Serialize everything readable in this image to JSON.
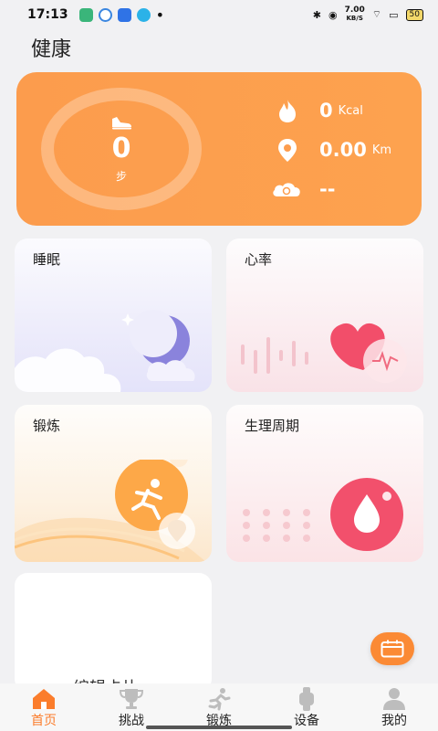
{
  "status_bar": {
    "time": "17:13",
    "net_speed_value": "7.00",
    "net_speed_unit": "KB/S",
    "battery": "50"
  },
  "page": {
    "title": "健康"
  },
  "summary": {
    "steps_value": "0",
    "steps_unit": "步",
    "calories_value": "0",
    "calories_unit": "Kcal",
    "distance_value": "0.00",
    "distance_unit": "Km",
    "sync_value": "--",
    "accent_color": "#fd9d4e"
  },
  "tiles": {
    "sleep": "睡眠",
    "heart_rate": "心率",
    "exercise": "锻炼",
    "cycle": "生理周期",
    "edit_card": "编辑卡片"
  },
  "bottom_nav": {
    "items": [
      {
        "label": "首页",
        "icon": "home-icon",
        "active": true
      },
      {
        "label": "挑战",
        "icon": "trophy-icon",
        "active": false
      },
      {
        "label": "锻炼",
        "icon": "runner-icon",
        "active": false
      },
      {
        "label": "设备",
        "icon": "watch-icon",
        "active": false
      },
      {
        "label": "我的",
        "icon": "profile-icon",
        "active": false
      }
    ],
    "active_color": "#fb7d2c"
  },
  "floating_button": {
    "icon": "calendar-icon"
  }
}
